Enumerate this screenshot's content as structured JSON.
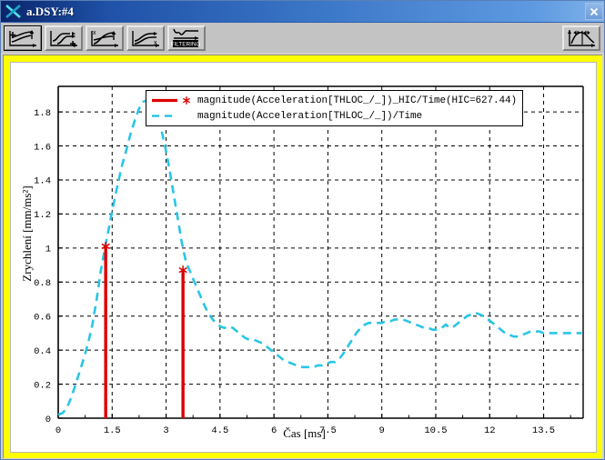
{
  "window": {
    "title": "a.DSY:#4",
    "logo_icon": "x-logo-icon",
    "close_label": "✕",
    "close_icon": "close-icon",
    "frame_color": "#ffff00",
    "titlebar_color": "#0a246a"
  },
  "toolbar": {
    "buttons": [
      {
        "name": "shift-curve-y-button",
        "icon": "curve-shift-y-icon",
        "label": "",
        "active": true
      },
      {
        "name": "shift-curve-x-button",
        "icon": "curve-shift-x-icon",
        "label": "",
        "active": false
      },
      {
        "name": "scale-curve-y-button",
        "icon": "curve-scale-y-icon",
        "label": "",
        "active": false
      },
      {
        "name": "scale-curve-x-button",
        "icon": "curve-scale-x-icon",
        "label": "",
        "active": false
      },
      {
        "name": "filtering-button",
        "icon": "filtering-icon",
        "label": "FILTERING",
        "active": false
      }
    ],
    "right_buttons": [
      {
        "name": "curve-measure-button",
        "icon": "curve-measure-icon",
        "label": "",
        "active": false
      }
    ]
  },
  "chart_data": {
    "type": "line",
    "title": "",
    "xlabel": "Čas [ms]",
    "ylabel": "Zrychlení [mm/ms²]",
    "xlim": [
      0,
      14.6
    ],
    "ylim": [
      0,
      1.95
    ],
    "xticks": [
      0,
      1.5,
      3,
      4.5,
      6,
      7.5,
      9,
      10.5,
      12,
      13.5
    ],
    "xtick_labels": [
      "0",
      "1.5",
      "3",
      "4.5",
      "6",
      "7.5",
      "9",
      "10.5",
      "12",
      "13.5"
    ],
    "yticks": [
      0,
      0.2,
      0.4,
      0.6,
      0.8,
      1,
      1.2,
      1.4,
      1.6,
      1.8
    ],
    "ytick_labels": [
      "0",
      "0.2",
      "0.4",
      "0.6",
      "0.8",
      "1",
      "1.2",
      "1.4",
      "1.6",
      "1.8"
    ],
    "grid": true,
    "legend_position": "top-center",
    "legend": [
      {
        "label": "magnitude(Acceleration[THLOC_/_])_HIC/Time(HIC=627.44)",
        "color": "#dd0000",
        "style": "solid",
        "marker": "asterisk",
        "name": "hic-series"
      },
      {
        "label": "magnitude(Acceleration[THLOC_/_])/Time",
        "color": "#29c5e6",
        "style": "dashed",
        "marker": "none",
        "name": "acceleration-series"
      }
    ],
    "annotations": [
      {
        "text": "HIC=627.44",
        "value": 627.44
      }
    ],
    "series": [
      {
        "name": "magnitude(Acceleration[THLOC_/_])/Time",
        "color": "#29c5e6",
        "style": "dashed",
        "x": [
          0.0,
          0.12,
          0.24,
          0.36,
          0.47,
          0.59,
          0.71,
          0.83,
          0.95,
          1.07,
          1.18,
          1.3,
          1.42,
          1.54,
          1.66,
          1.78,
          1.9,
          2.01,
          2.13,
          2.25,
          2.37,
          2.49,
          2.61,
          2.72,
          2.84,
          2.96,
          3.08,
          3.2,
          3.32,
          3.43,
          3.55,
          3.67,
          3.79,
          3.91,
          4.03,
          4.14,
          4.26,
          4.38,
          4.5,
          4.62,
          4.74,
          4.86,
          4.97,
          5.09,
          5.21,
          5.33,
          5.45,
          5.57,
          5.68,
          5.8,
          5.92,
          6.04,
          6.16,
          6.28,
          6.39,
          6.51,
          6.63,
          6.75,
          6.87,
          6.99,
          7.11,
          7.22,
          7.34,
          7.46,
          7.58,
          7.7,
          7.82,
          7.93,
          8.05,
          8.17,
          8.29,
          8.41,
          8.53,
          8.64,
          8.76,
          8.88,
          9.0,
          9.12,
          9.24,
          9.36,
          9.47,
          9.59,
          9.71,
          9.83,
          9.95,
          10.07,
          10.18,
          10.3,
          10.42,
          10.54,
          10.66,
          10.78,
          10.89,
          11.01,
          11.13,
          11.25,
          11.37,
          11.49,
          11.6,
          11.72,
          11.84,
          11.96,
          12.08,
          12.2,
          12.31,
          12.43,
          12.55,
          12.67,
          12.79,
          12.91,
          13.03,
          13.14,
          13.26,
          13.38,
          13.5,
          13.62,
          13.74,
          13.85,
          13.97,
          14.09,
          14.21,
          14.33,
          14.45,
          14.56
        ],
        "y": [
          0.02,
          0.03,
          0.06,
          0.12,
          0.19,
          0.27,
          0.35,
          0.44,
          0.55,
          0.7,
          0.86,
          1.0,
          1.13,
          1.26,
          1.38,
          1.49,
          1.58,
          1.67,
          1.75,
          1.82,
          1.86,
          1.87,
          1.85,
          1.8,
          1.72,
          1.61,
          1.48,
          1.33,
          1.18,
          1.04,
          0.92,
          0.86,
          0.8,
          0.74,
          0.68,
          0.63,
          0.59,
          0.56,
          0.54,
          0.53,
          0.54,
          0.53,
          0.51,
          0.49,
          0.47,
          0.46,
          0.46,
          0.45,
          0.44,
          0.42,
          0.4,
          0.38,
          0.36,
          0.34,
          0.33,
          0.32,
          0.31,
          0.3,
          0.3,
          0.3,
          0.3,
          0.31,
          0.31,
          0.32,
          0.33,
          0.33,
          0.35,
          0.38,
          0.42,
          0.46,
          0.5,
          0.53,
          0.55,
          0.56,
          0.56,
          0.56,
          0.56,
          0.57,
          0.57,
          0.58,
          0.58,
          0.58,
          0.57,
          0.56,
          0.55,
          0.54,
          0.53,
          0.53,
          0.52,
          0.52,
          0.53,
          0.55,
          0.53,
          0.54,
          0.56,
          0.58,
          0.6,
          0.61,
          0.62,
          0.61,
          0.6,
          0.58,
          0.56,
          0.54,
          0.52,
          0.5,
          0.49,
          0.48,
          0.48,
          0.49,
          0.5,
          0.51,
          0.51,
          0.51,
          0.5,
          0.5,
          0.5,
          0.5,
          0.5,
          0.5,
          0.5,
          0.5,
          0.5,
          0.5
        ]
      },
      {
        "name": "magnitude(Acceleration[THLOC_/_])_HIC/Time(HIC=627.44)",
        "color": "#dd0000",
        "style": "solid",
        "marker": "asterisk",
        "type": "vline",
        "points": [
          {
            "x": 1.32,
            "y": 1.01
          },
          {
            "x": 3.47,
            "y": 0.87
          }
        ]
      }
    ]
  }
}
